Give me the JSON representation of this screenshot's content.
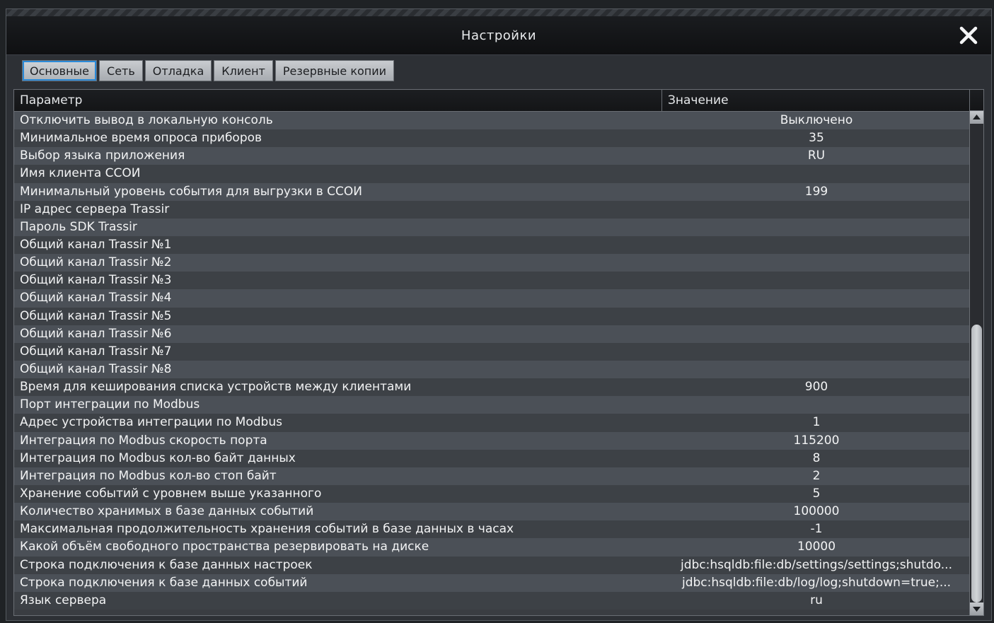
{
  "window": {
    "title": "Настройки",
    "close_icon": "close-icon"
  },
  "tabs": [
    {
      "label": "Основные",
      "active": true
    },
    {
      "label": "Сеть",
      "active": false
    },
    {
      "label": "Отладка",
      "active": false
    },
    {
      "label": "Клиент",
      "active": false
    },
    {
      "label": "Резервные копии",
      "active": false
    }
  ],
  "table": {
    "columns": {
      "param": "Параметр",
      "value": "Значение"
    },
    "rows": [
      {
        "param": "Отключить вывод в локальную консоль",
        "value": "Выключено"
      },
      {
        "param": "Минимальное время опроса приборов",
        "value": "35"
      },
      {
        "param": "Выбор языка приложения",
        "value": "RU"
      },
      {
        "param": "Имя клиента ССОИ",
        "value": ""
      },
      {
        "param": "Минимальный уровень события для выгрузки в ССОИ",
        "value": "199"
      },
      {
        "param": "IP адрес сервера Trassir",
        "value": ""
      },
      {
        "param": "Пароль SDK Trassir",
        "value": ""
      },
      {
        "param": "Общий канал Trassir №1",
        "value": ""
      },
      {
        "param": "Общий канал Trassir №2",
        "value": ""
      },
      {
        "param": "Общий канал Trassir №3",
        "value": ""
      },
      {
        "param": "Общий канал Trassir №4",
        "value": ""
      },
      {
        "param": "Общий канал Trassir №5",
        "value": ""
      },
      {
        "param": "Общий канал Trassir №6",
        "value": ""
      },
      {
        "param": "Общий канал Trassir №7",
        "value": ""
      },
      {
        "param": "Общий канал Trassir №8",
        "value": ""
      },
      {
        "param": "Время для кеширования списка устройств между клиентами",
        "value": "900"
      },
      {
        "param": "Порт интеграции по Modbus",
        "value": ""
      },
      {
        "param": "Адрес устройства интеграции по Modbus",
        "value": "1"
      },
      {
        "param": "Интеграция по Modbus скорость порта",
        "value": "115200"
      },
      {
        "param": "Интеграция по Modbus кол-во байт данных",
        "value": "8"
      },
      {
        "param": "Интеграция по Modbus кол-во стоп байт",
        "value": "2"
      },
      {
        "param": "Хранение событий с уровнем выше указанного",
        "value": "5"
      },
      {
        "param": "Количество хранимых в базе данных событий",
        "value": "100000"
      },
      {
        "param": "Максимальная продолжительность хранения событий в базе данных в часах",
        "value": "-1"
      },
      {
        "param": "Какой объём свободного пространства резервировать на диске",
        "value": "10000"
      },
      {
        "param": "Строка подключения к базе данных настроек",
        "value": "jdbc:hsqldb:file:db/settings/settings;shutdo..."
      },
      {
        "param": "Строка подключения к базе данных событий",
        "value": "jdbc:hsqldb:file:db/log/log;shutdown=true;..."
      },
      {
        "param": "Язык сервера",
        "value": "ru"
      }
    ]
  },
  "scrollbar": {
    "visible_fraction": 0.58,
    "position_fraction": 1.0,
    "up_icon": "arrow-up-icon",
    "down_icon": "arrow-down-icon"
  },
  "colors": {
    "accent": "#2a8ad8",
    "row_odd": "#4b5057",
    "row_even": "#3d4146",
    "titlebar": "#111214"
  }
}
